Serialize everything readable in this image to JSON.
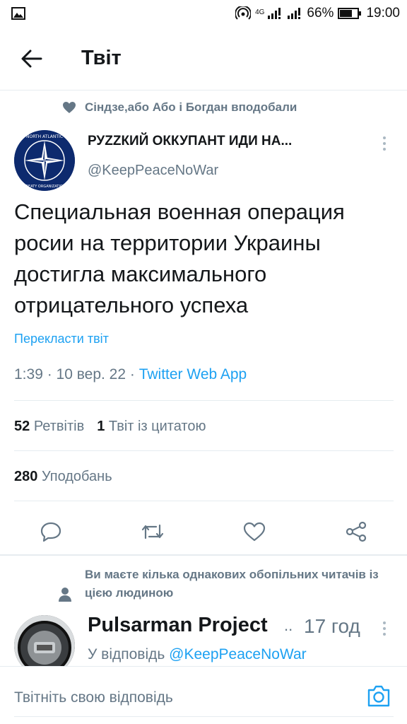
{
  "status_bar": {
    "network": "4G",
    "battery": "66%",
    "time": "19:00"
  },
  "header": {
    "title": "Твіт"
  },
  "tweet": {
    "social_context": "Сіндзе,або Або і Богдан вподобали",
    "author_name": "РУZZКИЙ ОККУПАНТ ИДИ НА...",
    "author_handle": "@KeepPeaceNoWar",
    "avatar_text_top": "NORTH ATLANTIC",
    "avatar_text_bottom": "TREATY ORGANIZATION",
    "text": "Специальная военная операция росии на территории Украины достигла максимального отрицательного успеха",
    "translate_label": "Перекласти твіт",
    "time": "1:39 · 10 вер. 22 · ",
    "source_app": "Twitter Web App",
    "retweets_count": "52",
    "retweets_label": "Ретвітів",
    "quotes_count": "1",
    "quotes_label": "Твіт із цитатою",
    "likes_count": "280",
    "likes_label": "Уподобань"
  },
  "reply": {
    "context": "Ви маєте кілька однакових обопільних читачів із цією людиною",
    "author_name": "Pulsarman Project",
    "dots": "..",
    "time": "17 год",
    "reply_to_label": "У відповідь",
    "reply_to_handle": "@KeepPeaceNoWar"
  },
  "composer": {
    "placeholder": "Твітніть свою відповідь"
  },
  "colors": {
    "accent": "#1da1f2",
    "secondary_text": "#657786",
    "divider": "#e6ecf0",
    "nato_blue": "#0d2a6e"
  }
}
